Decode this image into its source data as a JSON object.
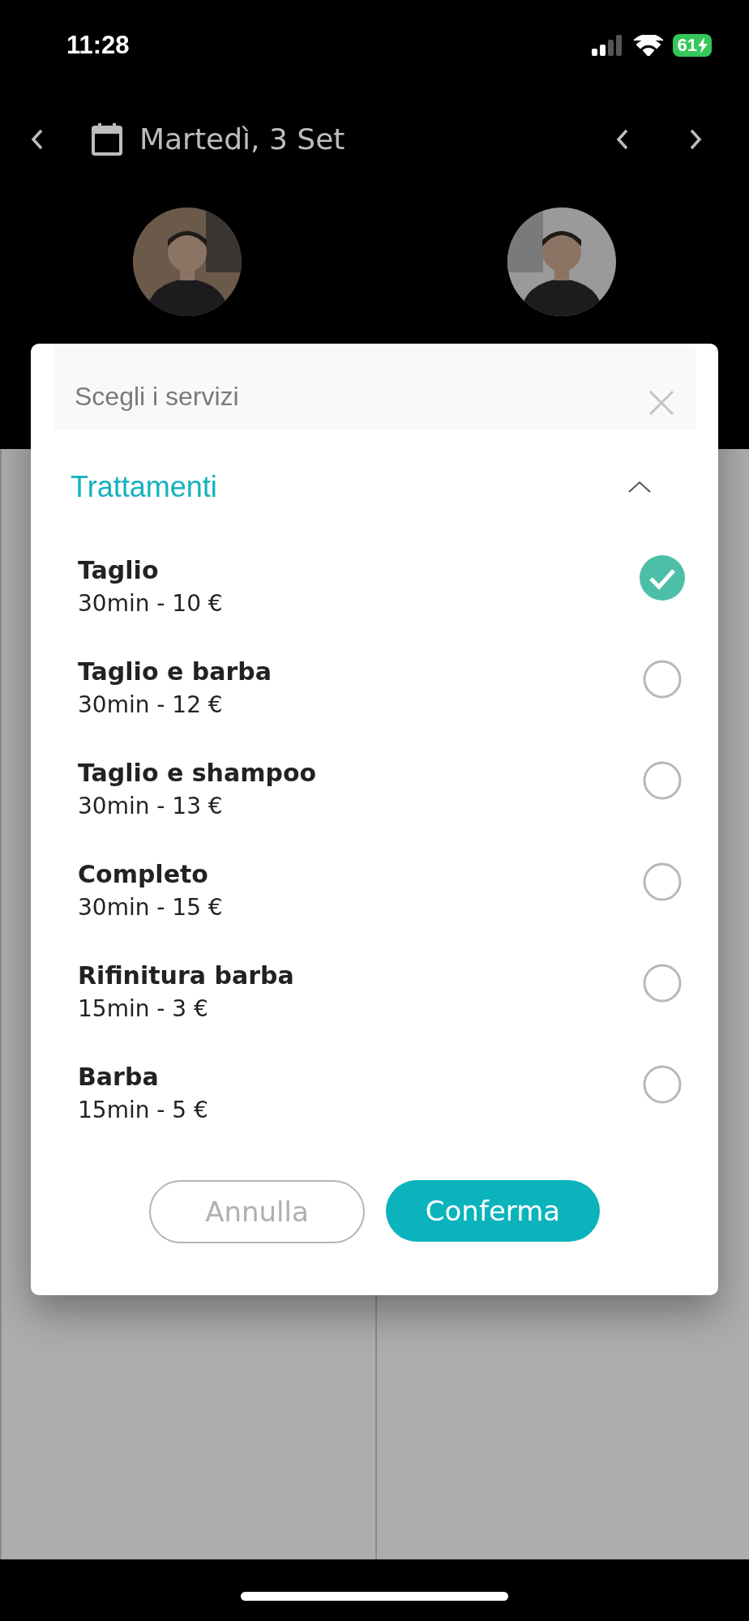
{
  "status_bar": {
    "time": "11:28",
    "battery": "61"
  },
  "header": {
    "date": "Martedì, 3 Set"
  },
  "dialog": {
    "title": "Scegli i servizi",
    "section": {
      "title": "Trattamenti",
      "expanded": true,
      "items": [
        {
          "name": "Taglio",
          "detail": "30min - 10 €",
          "selected": true
        },
        {
          "name": "Taglio e barba",
          "detail": "30min - 12 €",
          "selected": false
        },
        {
          "name": "Taglio e shampoo",
          "detail": "30min - 13 €",
          "selected": false
        },
        {
          "name": "Completo",
          "detail": "30min - 15 €",
          "selected": false
        },
        {
          "name": "Rifinitura barba",
          "detail": "15min - 3 €",
          "selected": false
        },
        {
          "name": "Barba",
          "detail": "15min - 5 €",
          "selected": false
        }
      ]
    },
    "buttons": [
      {
        "label": "Annulla",
        "kind": "secondary"
      },
      {
        "label": "Conferma",
        "kind": "primary"
      }
    ]
  }
}
